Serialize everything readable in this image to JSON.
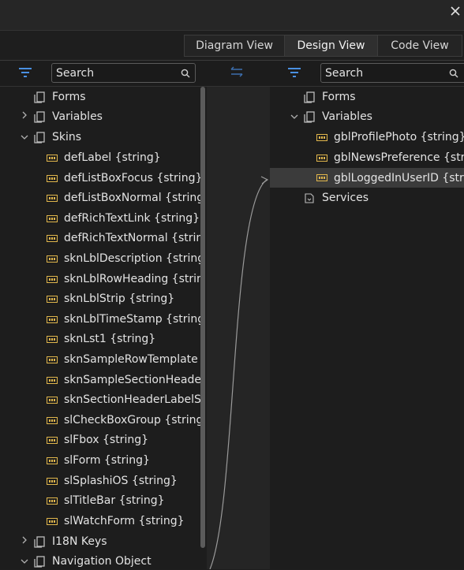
{
  "tabs": [
    "Diagram View",
    "Design View",
    "Code View"
  ],
  "search": {
    "left_placeholder": "Search",
    "right_placeholder": "Search"
  },
  "left_tree": {
    "forms": "Forms",
    "variables": "Variables",
    "skins": "Skins",
    "skin_items": [
      "defLabel {string}",
      "defListBoxFocus {string}",
      "defListBoxNormal {string}",
      "defRichTextLink {string}",
      "defRichTextNormal {string}",
      "sknLblDescription {string}",
      "sknLblRowHeading {string}",
      "sknLblStrip {string}",
      "sknLblTimeStamp {string}",
      "sknLst1 {string}",
      "sknSampleRowTemplate {string}",
      "sknSampleSectionHeaderTemplate {string}",
      "sknSectionHeaderLabelSkin {string}",
      "slCheckBoxGroup {string}",
      "slFbox {string}",
      "slForm {string}",
      "slSplashiOS {string}",
      "slTitleBar {string}",
      "slWatchForm {string}"
    ],
    "i18n": "I18N Keys",
    "navigation": "Navigation Object"
  },
  "right_tree": {
    "forms": "Forms",
    "variables": "Variables",
    "variable_items": [
      "gblProfilePhoto {string}",
      "gblNewsPreference {string}",
      "gblLoggedInUserID {string}"
    ],
    "services": "Services"
  },
  "colors": {
    "background": "#1e1e1e",
    "selected": "#3b3b3b",
    "variable_icon": "#e0b64c",
    "text": "#e3e3e3"
  },
  "icons": [
    "close-icon",
    "filter-icon",
    "search-icon",
    "swap-arrows-icon",
    "chevron-right-icon",
    "chevron-down-icon",
    "folder-stack-icon",
    "variable-icon",
    "service-icon"
  ]
}
